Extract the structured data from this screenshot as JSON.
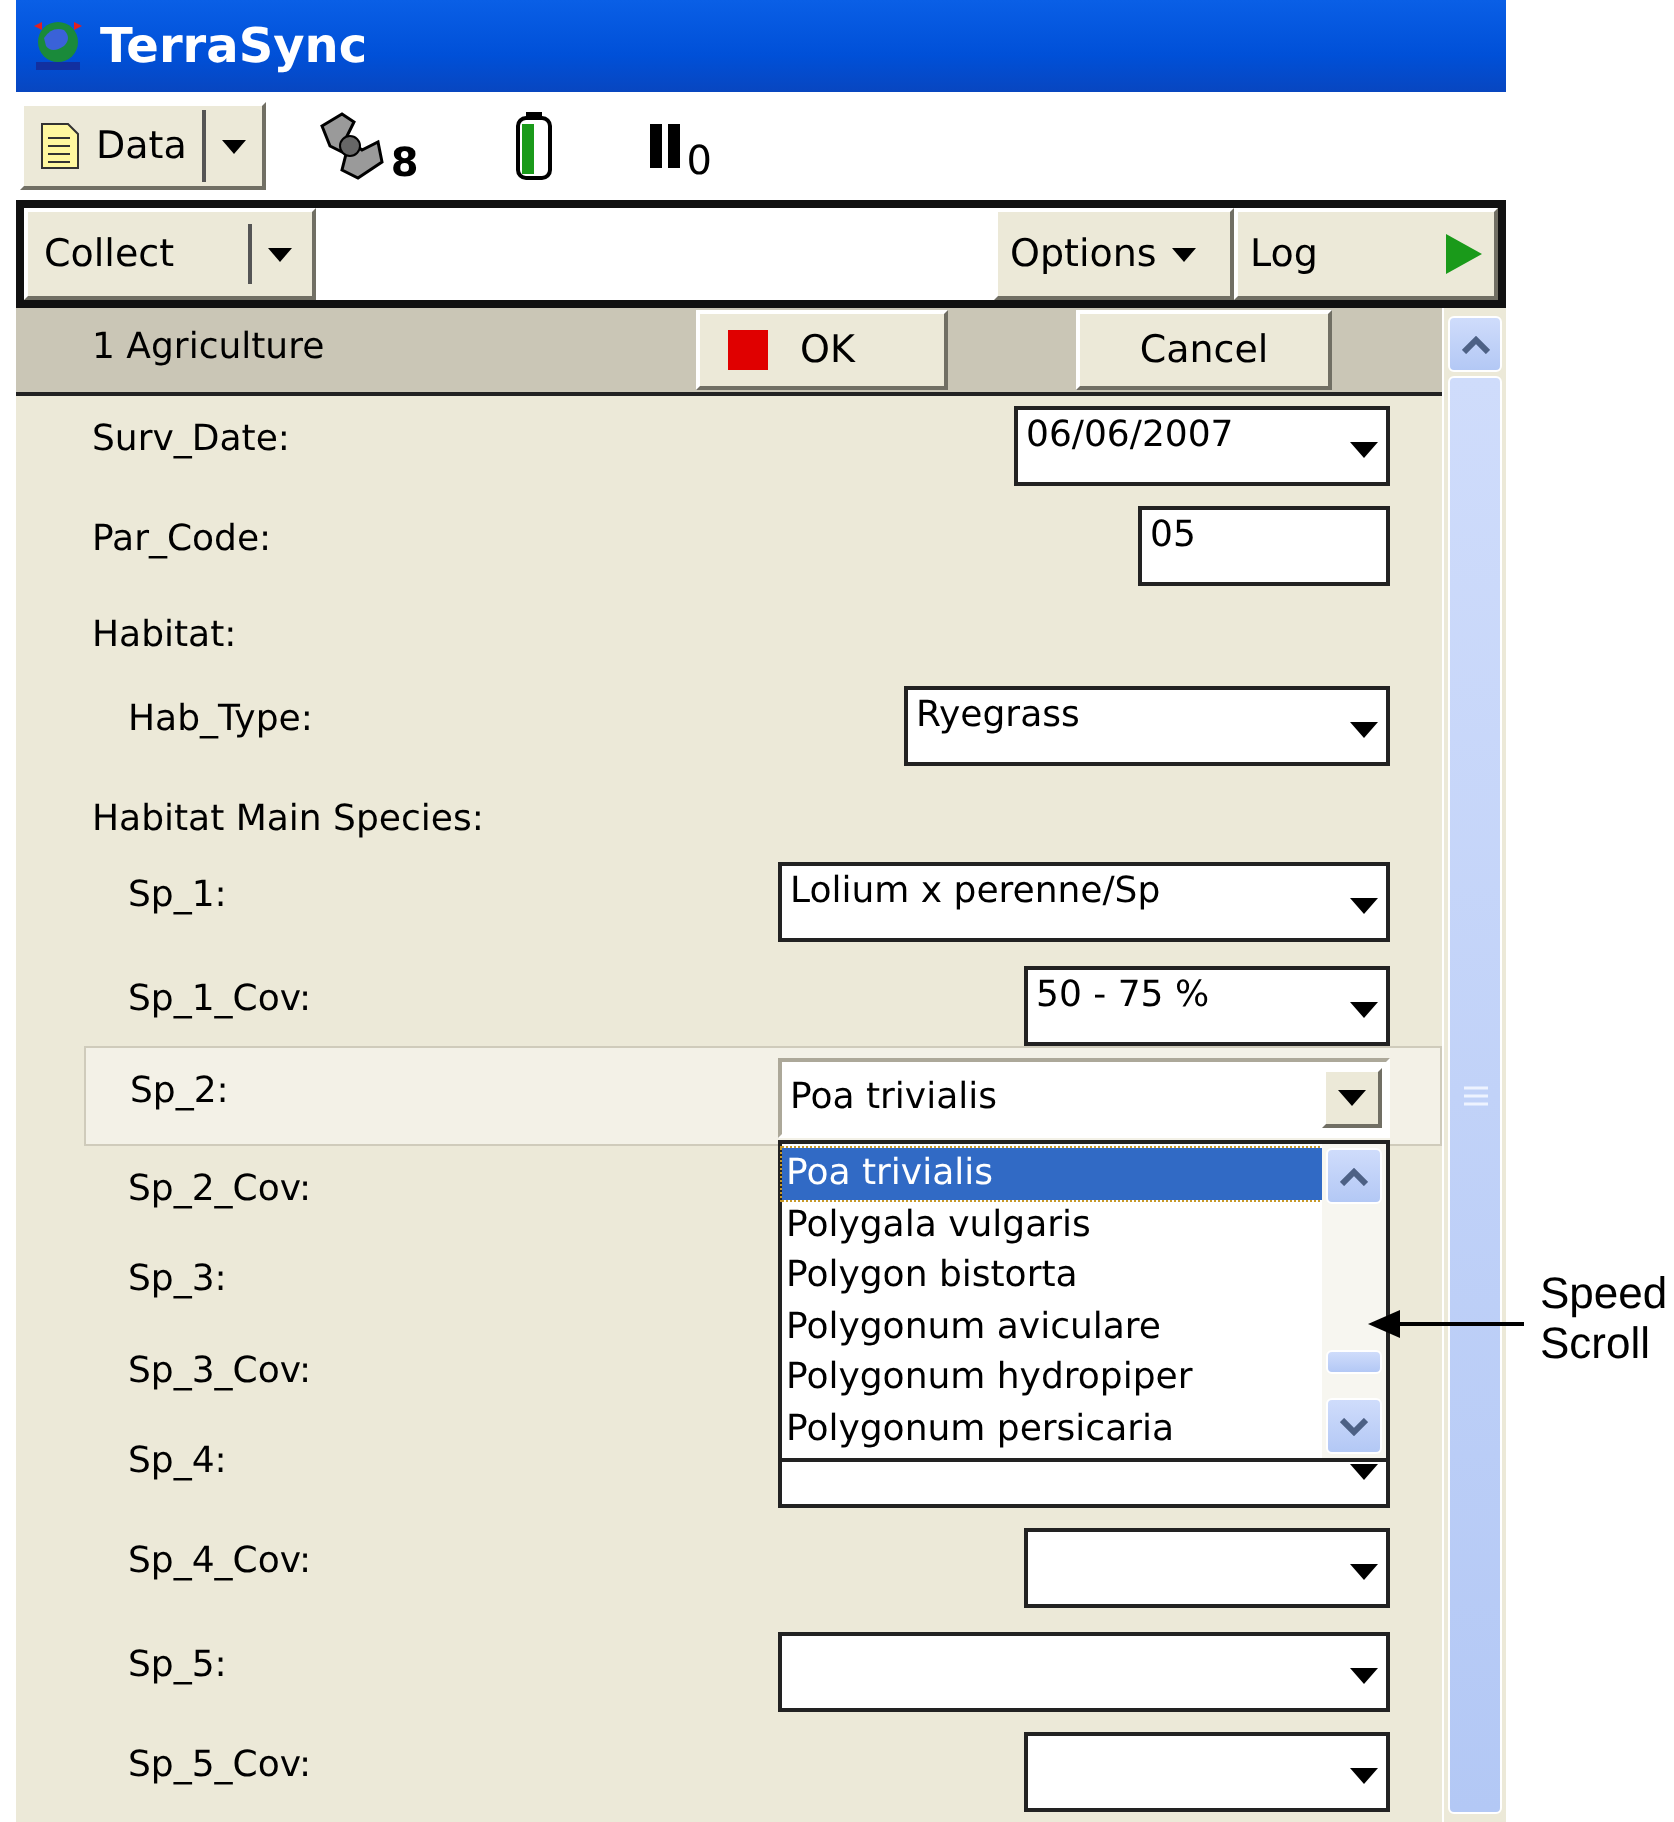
{
  "window": {
    "title": "TerraSync"
  },
  "toolbar": {
    "data_menu": "Data",
    "satellites": "8",
    "signal": "0"
  },
  "nav": {
    "collect": "Collect",
    "options": "Options",
    "log": "Log"
  },
  "form": {
    "feature": "1 Agriculture",
    "ok": "OK",
    "cancel": "Cancel",
    "rows": [
      {
        "label": "Surv_Date:",
        "kind": "dropdown",
        "value": "06/06/2007",
        "selected": false
      },
      {
        "label": "Par_Code:",
        "kind": "text",
        "value": "05",
        "selected": false
      },
      {
        "label": "Habitat:",
        "kind": "heading",
        "children": [
          {
            "label": "Hab_Type:",
            "kind": "dropdown",
            "value": "Ryegrass",
            "selected": false
          }
        ]
      },
      {
        "label": "Habitat Main Species:",
        "kind": "heading",
        "children": [
          {
            "label": "Sp_1:",
            "kind": "dropdown",
            "value": "Lolium x perenne/Sp",
            "selected": false
          },
          {
            "label": "Sp_1_Cov:",
            "kind": "dropdown",
            "value": "50 - 75 %",
            "selected": false
          },
          {
            "label": "Sp_2:",
            "kind": "dropdown",
            "value": "Poa trivialis",
            "selected": true,
            "expanded": true
          },
          {
            "label": "Sp_2_Cov:",
            "kind": "covered"
          },
          {
            "label": "Sp_3:",
            "kind": "covered"
          },
          {
            "label": "Sp_3_Cov:",
            "kind": "covered"
          },
          {
            "label": "Sp_4:",
            "kind": "dropdown",
            "selected": false
          },
          {
            "label": "Sp_4_Cov:",
            "kind": "dropdown",
            "selected": false
          },
          {
            "label": "Sp_5:",
            "kind": "dropdown",
            "selected": false
          },
          {
            "label": "Sp_5_Cov:",
            "kind": "dropdown",
            "selected": false
          }
        ]
      }
    ]
  },
  "list": {
    "items": [
      {
        "label": "Poa trivialis",
        "selected": true
      },
      {
        "label": "Polygala vulgaris",
        "selected": false
      },
      {
        "label": "Polygon bistorta",
        "selected": false
      },
      {
        "label": "Polygonum aviculare",
        "selected": false
      },
      {
        "label": "Polygonum hydropiper",
        "selected": false
      },
      {
        "label": "Polygonum persicaria",
        "selected": false
      }
    ]
  },
  "annotation": "Speed Scroll"
}
